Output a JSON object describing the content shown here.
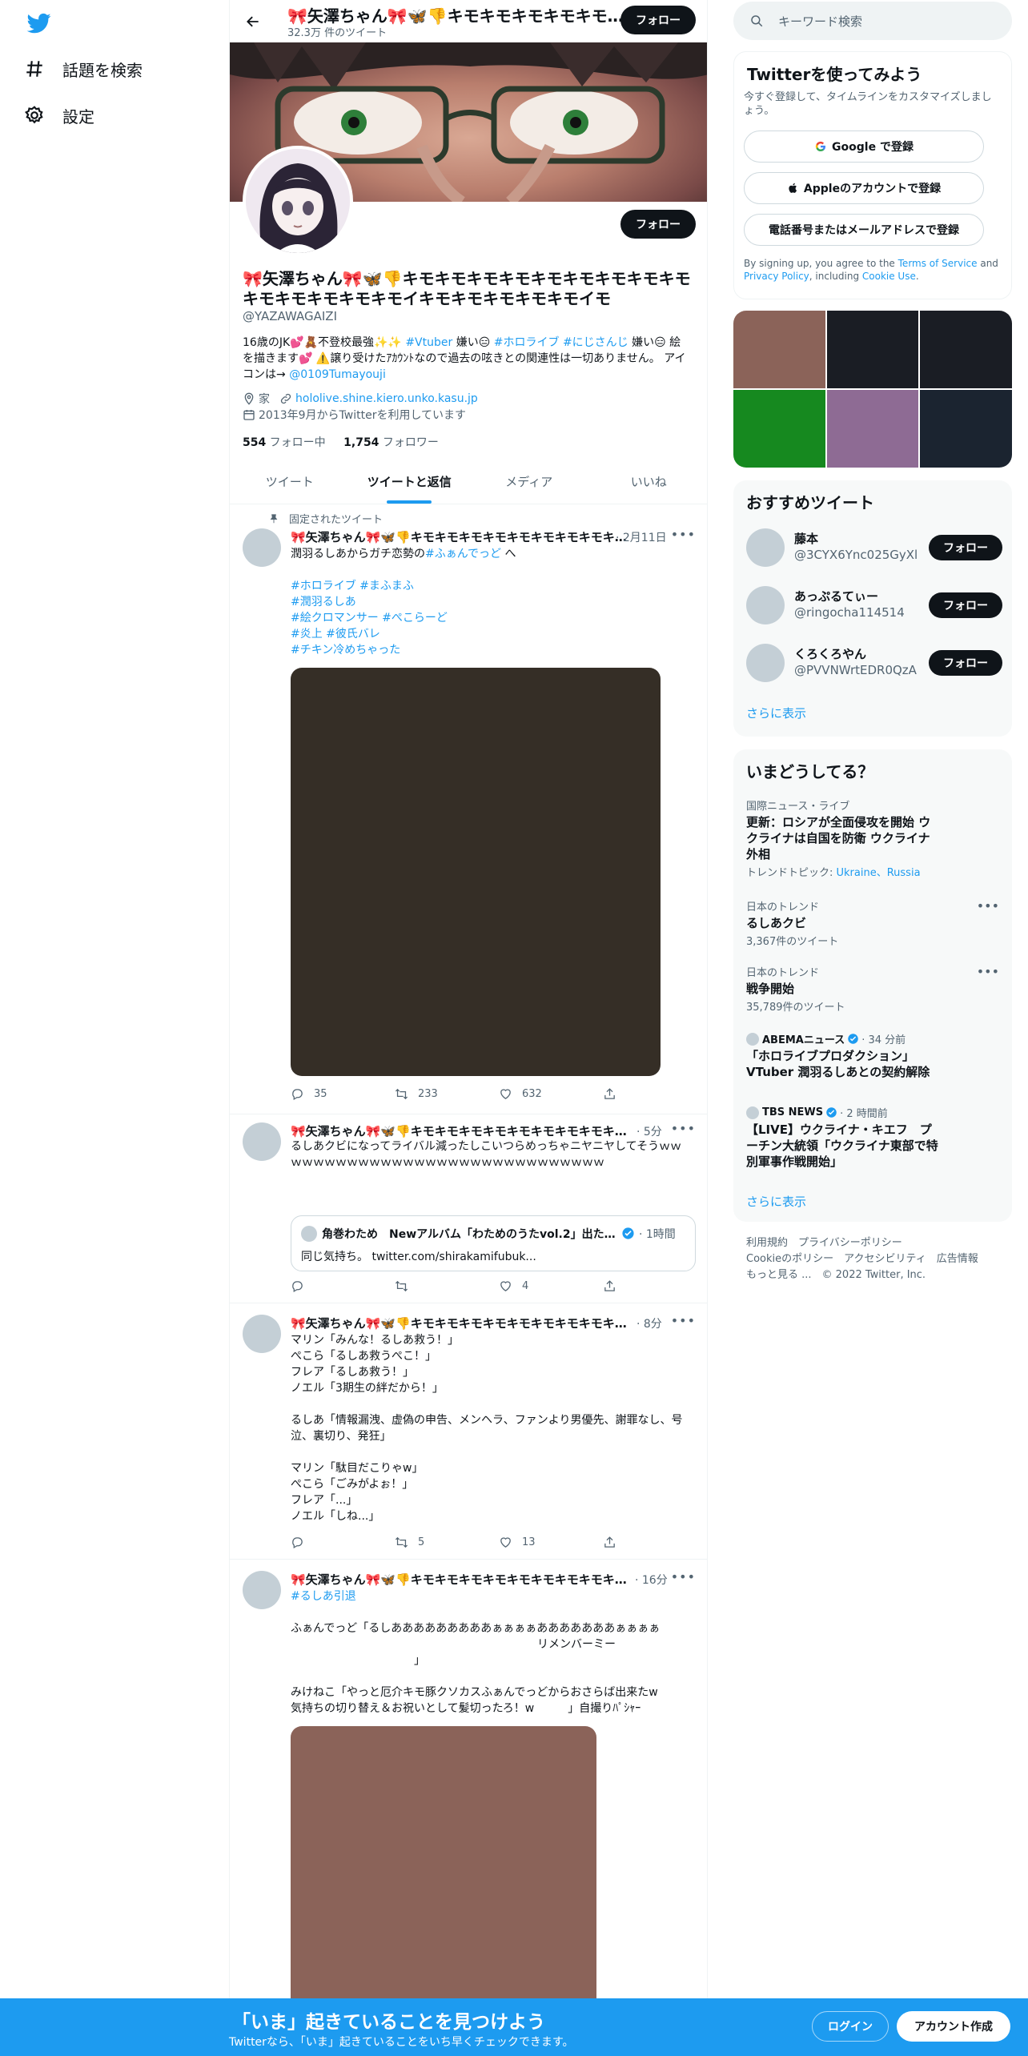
{
  "nav": {
    "items": [
      {
        "label": "話題を検索",
        "icon": "hashtag-icon"
      },
      {
        "label": "設定",
        "icon": "gear-icon"
      }
    ]
  },
  "header": {
    "name": "🎀矢澤ちゃん🎀🦋👎キモキモキモキモキモキモキモキモキモキモキモキモ",
    "tweet_count": "32.3万 件のツイート",
    "follow_label": "フォロー"
  },
  "profile": {
    "name": "🎀矢澤ちゃん🎀🦋👎キモキモキモキモキモキモキモキモキモキモキモキモキモキモイキモキモキモキモキモイモ",
    "handle": "@YAZAWAGAIZI",
    "follow_label": "フォロー",
    "bio": {
      "t1": "16歳のJK💕🧸不登校最強✨✨ ",
      "h1": "#Vtuber",
      "t2": " 嫌い😑 ",
      "h2": "#ホロライブ",
      "t3": " ",
      "h3": "#にじさんじ",
      "t4": " 嫌い😑 絵を描きます💕 ⚠️譲り受けたｱｶｳﾝﾄなので過去の呟きとの関連性は一切ありません。 アイコンは→ ",
      "mention": "@0109Tumayouji"
    },
    "location": "家",
    "url": "hololive.shine.kiero.unko.kasu.jp",
    "joined": "2013年9月からTwitterを利用しています",
    "following_count": "554",
    "following_label": " フォロー中",
    "followers_count": "1,754",
    "followers_label": " フォロワー"
  },
  "tabs": [
    {
      "label": "ツイート"
    },
    {
      "label": "ツイートと返信"
    },
    {
      "label": "メディア"
    },
    {
      "label": "いいね"
    }
  ],
  "tweets": [
    {
      "pinned_label": "固定されたツイート",
      "name": "🎀矢澤ちゃん🎀🦋👎キモキモキモキモキモキモキモキモキモキモキモキモ",
      "time": "· 2月11日",
      "text_a": "潤羽るしあからガチ恋勢の",
      "text_tag": "#ふぁんでっど",
      "text_b": " へ",
      "tags": [
        "#ホロライブ #まふまふ",
        "#潤羽るしあ",
        "#絵クロマンサー #ぺこらーど",
        "#炎上 #彼氏バレ",
        "#チキン冷めちゃった"
      ],
      "replies": "35",
      "retweets": "233",
      "likes": "632"
    },
    {
      "name": "🎀矢澤ちゃん🎀🦋👎キモキモキモキモキモキモキモキモキモキモキモキモ",
      "time": "· 5分",
      "text": "るしあクビになってライバル減ったしこいつらめっちゃニヤニヤしてそうｗｗｗｗｗｗｗｗｗｗｗｗｗｗｗｗｗｗｗｗｗｗｗｗｗｗｗｗｗｗ",
      "quote_name": "角巻わため　Newアルバム「わためのうたvol.2」出たよ！",
      "quote_time": "· 1時間",
      "quote_text": "同じ気持ち。 twitter.com/shirakamifubuk...",
      "likes": "4"
    },
    {
      "name": "🎀矢澤ちゃん🎀🦋👎キモキモキモキモキモキモキモキモキモキモキモキモ",
      "time": "· 8分",
      "text": "マリン「みんな！るしあ救う！」\nぺこら「るしあ救うぺこ！」\nフレア「るしあ救う！」\nノエル「3期生の絆だから！」\n\nるしあ「情報漏洩、虚偽の申告、メンヘラ、ファンより男優先、謝罪なし、号泣、裏切り、発狂」\n\nマリン「駄目だこりゃw」\nぺこら「ごみがよぉ！」\nフレア「...」\nノエル「しね...」",
      "retweets": "5",
      "likes": "13"
    },
    {
      "name": "🎀矢澤ちゃん🎀🦋👎キモキモキモキモキモキモキモキモキモキモキモキモ",
      "time": "· 16分",
      "tag": "#るしあ引退",
      "text": "ふぁんでっど「るしあああああああああぁぁぁぁあああああああぁぁぁぁ\n　　　　　　　　　　　　　　　　　　　　　　リメンバーミー\n　　　　　　　　　　　」\n\nみけねこ「やっと厄介キモ豚クソカスふぁんでっどからおさらば出来たw\n気持ちの切り替え＆お祝いとして髪切ったろ！w　　　」自撮りﾊﾟｼｬｰ"
    }
  ],
  "search": {
    "placeholder": "キーワード検索"
  },
  "signup_card": {
    "title": "Twitterを使ってみよう",
    "subtitle": "今すぐ登録して、タイムラインをカスタマイズしましょう。",
    "google_label": "Google で登録",
    "apple_label": "Appleのアカウントで登録",
    "phone_label": "電話番号またはメールアドレスで登録",
    "terms_a": "By signing up, you agree to the ",
    "terms_link1": "Terms of Service",
    "terms_b": " and ",
    "terms_link2": "Privacy Policy",
    "terms_c": ", including ",
    "terms_link3": "Cookie Use",
    "terms_d": "."
  },
  "photo_colors": [
    "#8b6359",
    "#1a1d24",
    "#1a1d24",
    "#16891f",
    "#8e6b94",
    "#1b2430"
  ],
  "recommend": {
    "title": "おすすめツイート",
    "users": [
      {
        "name": "藤本",
        "handle": "@3CYX6Ync025GyXl"
      },
      {
        "name": "あっぷるてぃー",
        "handle": "@ringocha114514"
      },
      {
        "name": "くろくろやん",
        "handle": "@PVVNWrtEDR0QzA"
      }
    ],
    "follow_label": "フォロー",
    "more": "さらに表示"
  },
  "trends": {
    "title": "いまどうしてる？",
    "items": [
      {
        "context": "国際ニュース・ライブ",
        "title": "更新：ロシアが全面侵攻を開始 ウクライナは自国を防衛 ウクライナ外相",
        "topic_label": "トレンドトピック: ",
        "topic_links": "Ukraine、Russia"
      },
      {
        "context": "日本のトレンド",
        "title": "るしあクビ",
        "count": "3,367件のツイート"
      },
      {
        "context": "日本のトレンド",
        "title": "戦争開始",
        "count": "35,789件のツイート"
      },
      {
        "source": "ABEMAニュース",
        "time": "· 34 分前",
        "title": "「ホロライブプロダクション」VTuber 潤羽るしあとの契約解除"
      },
      {
        "source": "TBS NEWS",
        "time": "· 2 時間前",
        "title": "【LIVE】ウクライナ・キエフ　プーチン大統領「ウクライナ東部で特別軍事作戦開始」"
      }
    ],
    "more": "さらに表示"
  },
  "footer": {
    "l1": "利用規約　プライバシーポリシー",
    "l2": "Cookieのポリシー　アクセシビリティ　広告情報",
    "l3": "もっと見る ...　© 2022 Twitter, Inc."
  },
  "bottom": {
    "title": "「いま」起きていることを見つけよう",
    "subtitle": "Twitterなら、「いま」起きていることをいち早くチェックできます。",
    "login": "ログイン",
    "signup": "アカウント作成"
  }
}
